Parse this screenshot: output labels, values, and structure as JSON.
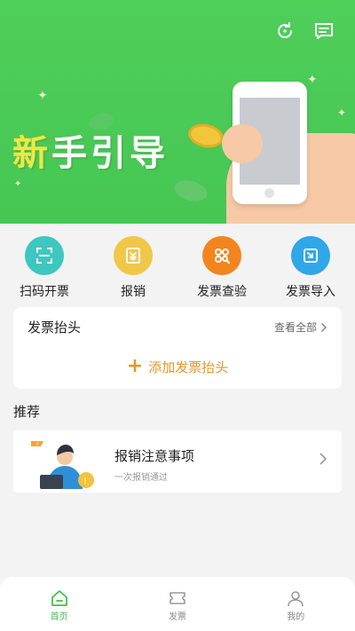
{
  "banner": {
    "title_first": "新",
    "title_rest": "手引导",
    "refresh_icon": "refresh-icon",
    "message_icon": "message-icon",
    "colors": {
      "bg": "#4fce5a",
      "accent": "#f4e641"
    }
  },
  "actions": [
    {
      "label": "扫码开票",
      "icon": "scan-icon",
      "color": "#3ec7c0"
    },
    {
      "label": "报销",
      "icon": "reimburse-icon",
      "color": "#f1c74a"
    },
    {
      "label": "发票查验",
      "icon": "verify-icon",
      "color": "#f3851f"
    },
    {
      "label": "发票导入",
      "icon": "import-icon",
      "color": "#2fa7e8"
    }
  ],
  "invoice_header": {
    "title": "发票抬头",
    "view_all": "查看全部",
    "add_label": "添加发票抬头",
    "accent": "#e3962b"
  },
  "recommend": {
    "section_title": "推荐",
    "item": {
      "title": "报销注意事项",
      "subtitle": "一次报销通过"
    }
  },
  "tabbar": {
    "items": [
      {
        "label": "首页",
        "icon": "home-icon",
        "active": true
      },
      {
        "label": "发票",
        "icon": "ticket-icon",
        "active": false
      },
      {
        "label": "我的",
        "icon": "user-icon",
        "active": false
      }
    ],
    "active_color": "#44bd4f"
  }
}
